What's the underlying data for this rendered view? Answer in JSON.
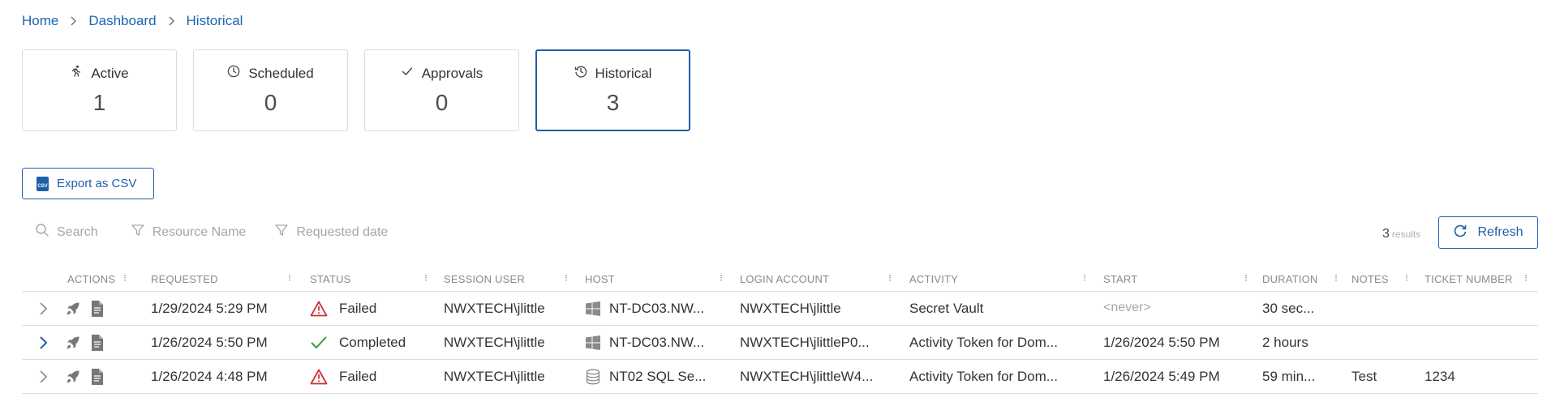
{
  "breadcrumb": {
    "home": "Home",
    "dashboard": "Dashboard",
    "current": "Historical"
  },
  "cards": [
    {
      "label": "Active",
      "count": "1",
      "icon": "running-person-icon"
    },
    {
      "label": "Scheduled",
      "count": "0",
      "icon": "clock-icon"
    },
    {
      "label": "Approvals",
      "count": "0",
      "icon": "checkmark-icon"
    },
    {
      "label": "Historical",
      "count": "3",
      "icon": "history-icon",
      "selected": true
    }
  ],
  "toolbar": {
    "export_label": "Export as CSV",
    "csv_icon_text": "CSV"
  },
  "filters": {
    "search": "Search",
    "resource": "Resource Name",
    "requested_date": "Requested date"
  },
  "results": {
    "count": "3",
    "unit": "results"
  },
  "refresh_label": "Refresh",
  "columns": [
    "ACTIONS",
    "REQUESTED",
    "STATUS",
    "SESSION USER",
    "HOST",
    "LOGIN ACCOUNT",
    "ACTIVITY",
    "START",
    "DURATION",
    "NOTES",
    "TICKET NUMBER"
  ],
  "rows": [
    {
      "requested": "1/29/2024 5:29 PM",
      "status": "Failed",
      "status_type": "failed",
      "session_user": "NWXTECH\\jlittle",
      "host": "NT-DC03.NW...",
      "host_icon": "windows-icon",
      "login_account": "NWXTECH\\jlittle",
      "activity": "Secret Vault",
      "start": "<never>",
      "duration": "30 sec...",
      "notes": "",
      "ticket": "",
      "expanded": false
    },
    {
      "requested": "1/26/2024 5:50 PM",
      "status": "Completed",
      "status_type": "completed",
      "session_user": "NWXTECH\\jlittle",
      "host": "NT-DC03.NW...",
      "host_icon": "windows-icon",
      "login_account": "NWXTECH\\jlittleP0...",
      "activity": "Activity Token for Dom...",
      "start": "1/26/2024 5:50 PM",
      "duration": "2 hours",
      "notes": "",
      "ticket": "",
      "expanded": true
    },
    {
      "requested": "1/26/2024 4:48 PM",
      "status": "Failed",
      "status_type": "failed",
      "session_user": "NWXTECH\\jlittle",
      "host": "NT02 SQL Se...",
      "host_icon": "database-icon",
      "login_account": "NWXTECH\\jlittleW4...",
      "activity": "Activity Token for Dom...",
      "start": "1/26/2024 5:49 PM",
      "duration": "59 min...",
      "notes": "Test",
      "ticket": "1234",
      "expanded": false
    }
  ],
  "colors": {
    "accent": "#1f5fa6",
    "link": "#1a64b2",
    "failed": "#d32f2f",
    "completed": "#2e9e44",
    "muted": "#a6a6a6"
  }
}
